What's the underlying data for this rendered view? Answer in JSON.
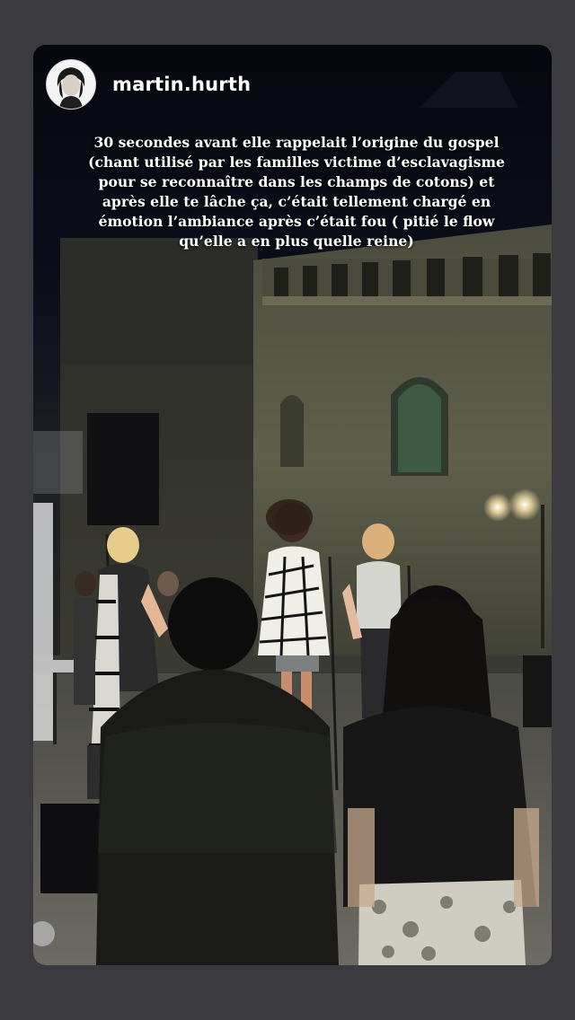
{
  "story": {
    "username": "martin.hurth",
    "caption": "30 secondes avant elle rappelait l’origine du gospel (chant utilisé par les familles victime d’esclavagisme pour se reconnaître dans les champs de cotons) et après elle te lâche ça, c’était tellement chargé en émotion l’ambiance après c’était fou ( pitié le flow qu’elle a en plus quelle reine)"
  },
  "colors": {
    "page_background": "#3b3b3f",
    "night_sky": "#0a0c16",
    "castle_stone": "#5a5a48",
    "text": "#ffffff"
  },
  "icons": {
    "avatar": "profile-photo"
  }
}
